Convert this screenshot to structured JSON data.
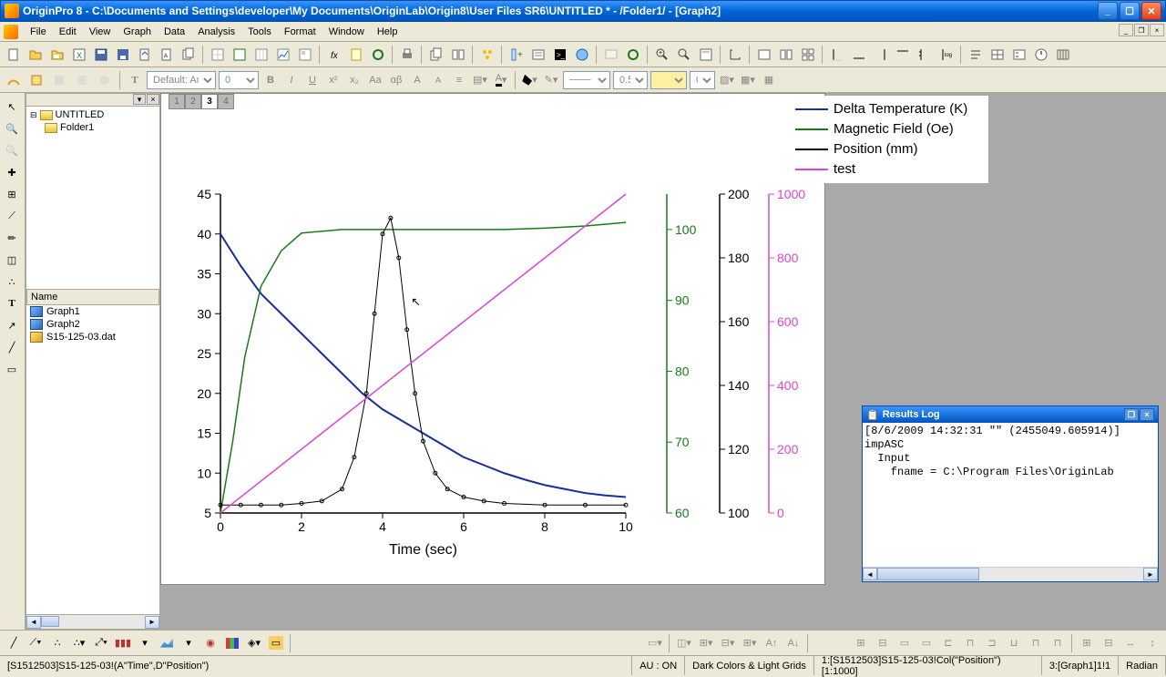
{
  "window": {
    "title": "OriginPro 8 - C:\\Documents and Settings\\developer\\My Documents\\OriginLab\\Origin8\\User Files SR6\\UNTITLED * - /Folder1/ - [Graph2]"
  },
  "menu": {
    "items": [
      "File",
      "Edit",
      "View",
      "Graph",
      "Data",
      "Analysis",
      "Tools",
      "Format",
      "Window",
      "Help"
    ]
  },
  "format_bar": {
    "font": "Default: Ar",
    "size": "0",
    "line_width": "0.5",
    "extra": "0"
  },
  "project": {
    "root": "UNTITLED",
    "folder": "Folder1",
    "name_header": "Name",
    "items": [
      {
        "label": "Graph1",
        "type": "graph"
      },
      {
        "label": "Graph2",
        "type": "graph"
      },
      {
        "label": "S15-125-03.dat",
        "type": "data"
      }
    ]
  },
  "tabs": {
    "labels": [
      "1",
      "2",
      "3",
      "4"
    ],
    "active": 2
  },
  "legend": {
    "items": [
      {
        "label": "Delta Temperature (K)",
        "color": "#1a2e9a"
      },
      {
        "label": "Magnetic Field (Oe)",
        "color": "#1a7a1a"
      },
      {
        "label": "Position (mm)",
        "color": "#000000"
      },
      {
        "label": "test",
        "color": "#d946cf"
      }
    ]
  },
  "chart_data": {
    "type": "line",
    "xlabel": "Time (sec)",
    "x_range": [
      0,
      10
    ],
    "x_ticks": [
      0,
      2,
      4,
      6,
      8,
      10
    ],
    "axes": [
      {
        "label": "",
        "range": [
          5,
          45
        ],
        "ticks": [
          5,
          10,
          15,
          20,
          25,
          30,
          35,
          40,
          45
        ],
        "color": "#000000",
        "side": "left"
      },
      {
        "label": "",
        "range": [
          60,
          105
        ],
        "ticks": [
          60,
          70,
          80,
          90,
          100
        ],
        "color": "#1a7a1a",
        "side": "right",
        "offset": 0
      },
      {
        "label": "",
        "range": [
          100,
          200
        ],
        "ticks": [
          100,
          120,
          140,
          160,
          180,
          200
        ],
        "color": "#000000",
        "side": "right",
        "offset": 58
      },
      {
        "label": "",
        "range": [
          0,
          1000
        ],
        "ticks": [
          0,
          200,
          400,
          600,
          800,
          1000
        ],
        "color": "#d946cf",
        "side": "right",
        "offset": 112
      }
    ],
    "series": [
      {
        "name": "Delta Temperature (K)",
        "color": "#1a2e9a",
        "axis": 0,
        "x": [
          0,
          0.5,
          1,
          1.5,
          2,
          2.5,
          3,
          3.5,
          4,
          4.5,
          5,
          5.5,
          6,
          6.5,
          7,
          7.5,
          8,
          8.5,
          9,
          9.5,
          10
        ],
        "y": [
          40,
          36,
          32.5,
          30,
          27.5,
          25,
          22.5,
          20,
          18,
          16.5,
          15,
          13.5,
          12,
          11,
          10,
          9.2,
          8.5,
          8,
          7.5,
          7.2,
          7
        ]
      },
      {
        "name": "Magnetic Field (Oe)",
        "color": "#1a7a1a",
        "axis": 1,
        "x": [
          0,
          0.3,
          0.6,
          1,
          1.5,
          2,
          3,
          4,
          5,
          6,
          7,
          8,
          9,
          10
        ],
        "y": [
          60,
          70,
          82,
          92,
          97,
          99.5,
          100,
          100,
          100,
          100,
          100,
          100.2,
          100.5,
          101
        ]
      },
      {
        "name": "Position (mm)",
        "color": "#000000",
        "axis": 0,
        "style": "scatter",
        "x": [
          0,
          0.5,
          1,
          1.5,
          2,
          2.5,
          3,
          3.3,
          3.6,
          3.8,
          4,
          4.2,
          4.4,
          4.6,
          4.8,
          5,
          5.3,
          5.6,
          6,
          6.5,
          7,
          8,
          9,
          10
        ],
        "y": [
          6,
          6,
          6,
          6,
          6.2,
          6.5,
          8,
          12,
          20,
          30,
          40,
          42,
          37,
          28,
          20,
          14,
          10,
          8,
          7,
          6.5,
          6.2,
          6,
          6,
          6
        ]
      },
      {
        "name": "test",
        "color": "#d946cf",
        "axis": 3,
        "x": [
          0,
          10
        ],
        "y": [
          0,
          1000
        ]
      }
    ]
  },
  "results_log": {
    "title": "Results Log",
    "lines": [
      "[8/6/2009 14:32:31 \"\" (2455049.605914)]",
      "impASC",
      "  Input",
      "    fname = C:\\Program Files\\OriginLab"
    ]
  },
  "status": {
    "left": "[S1512503]S15-125-03!(A\"Time\",D\"Position\")",
    "au": "AU : ON",
    "colors": "Dark Colors & Light Grids",
    "col1": "1:[S1512503]S15-125-03!Col(\"Position\")[1:1000]",
    "col2": "3:[Graph1]1!1",
    "angle": "Radian"
  }
}
